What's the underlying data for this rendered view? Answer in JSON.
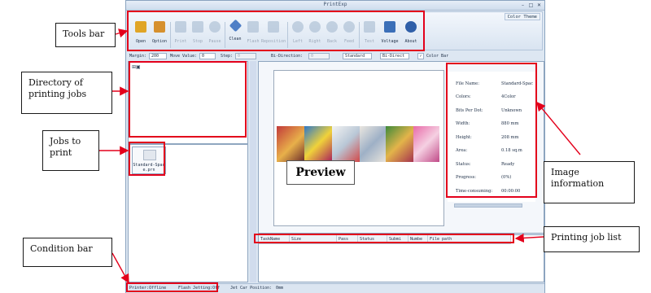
{
  "app": {
    "title": "PrintExp",
    "color_theme": "Color Theme",
    "window_controls": {
      "minimize": "–",
      "maximize": "□",
      "close": "✕"
    }
  },
  "toolbar": {
    "items": [
      {
        "label": "Open",
        "icon": "folder-open-icon",
        "enabled": true,
        "color": "#e0a526"
      },
      {
        "label": "Option",
        "icon": "settings-icon",
        "enabled": true,
        "color": "#d6902e"
      },
      {
        "label": "Print",
        "icon": "print-icon",
        "enabled": false,
        "color": "#9fb4cc"
      },
      {
        "label": "Stop",
        "icon": "stop-icon",
        "enabled": false,
        "color": "#9fb4cc"
      },
      {
        "label": "Pause",
        "icon": "pause-icon",
        "enabled": false,
        "color": "#9fb4cc"
      },
      {
        "label": "Clean",
        "icon": "clean-icon",
        "enabled": true,
        "color": "#4f7fc6"
      },
      {
        "label": "Flash",
        "icon": "flash-icon",
        "enabled": false,
        "color": "#9fb4cc"
      },
      {
        "label": "Reposition",
        "icon": "reposition-icon",
        "enabled": false,
        "color": "#9fb4cc"
      },
      {
        "label": "Left",
        "icon": "arrow-left-icon",
        "enabled": false,
        "color": "#9fb4cc"
      },
      {
        "label": "Right",
        "icon": "arrow-right-icon",
        "enabled": false,
        "color": "#9fb4cc"
      },
      {
        "label": "Back",
        "icon": "arrow-back-icon",
        "enabled": false,
        "color": "#9fb4cc"
      },
      {
        "label": "Feed",
        "icon": "arrow-feed-icon",
        "enabled": false,
        "color": "#9fb4cc"
      },
      {
        "label": "Test",
        "icon": "test-icon",
        "enabled": false,
        "color": "#9fb4cc"
      },
      {
        "label": "Voltage",
        "icon": "voltage-icon",
        "enabled": true,
        "color": "#3b6fb8"
      },
      {
        "label": "About",
        "icon": "about-icon",
        "enabled": true,
        "color": "#2f5fa8"
      }
    ]
  },
  "params": {
    "margin_label": "Margin:",
    "margin_value": "200",
    "move_value_label": "Move Value:",
    "move_value": "0",
    "step_label": "Step:",
    "step_value": "0",
    "bi_direction_label": "Bi-Direction:",
    "bi_direction_value": "0",
    "mode_value": "Standard",
    "direction_value": "Bi-Direct",
    "color_bar_label": "Color Bar",
    "color_bar_checked": true
  },
  "job_thumbnail": {
    "caption": "Standard-Spac\ne.prn"
  },
  "image_info": {
    "rows": [
      {
        "key": "File Name:",
        "value": "Standard-Spac"
      },
      {
        "key": "Colors:",
        "value": "4Color"
      },
      {
        "key": "Bits Per Dot:",
        "value": "Unknown"
      },
      {
        "key": "Width:",
        "value": "880 mm"
      },
      {
        "key": "Height:",
        "value": "208 mm"
      },
      {
        "key": "Area:",
        "value": "0.18 sq.m"
      },
      {
        "key": "Status:",
        "value": "Ready"
      },
      {
        "key": "Progress:",
        "value": "(0%)"
      },
      {
        "key": "Time-consuming:",
        "value": "00:00:00"
      }
    ]
  },
  "job_list": {
    "columns": [
      "TaskName",
      "Size",
      "Pass",
      "Status",
      "Submi",
      "Numbe",
      "File path"
    ]
  },
  "status_bar": {
    "printer_status": "Printer:Offline",
    "flash_status": "Flash Jetting:Off",
    "jet_car_position": "Jet Car Position:",
    "jet_car_value": "0mm"
  },
  "annotations": {
    "tools_bar": "Tools bar",
    "directory": "Directory of printing jobs",
    "jobs_to_print": "Jobs to print",
    "condition_bar": "Condition bar",
    "preview": "Preview",
    "image_information": "Image information",
    "printing_job_list": "Printing job list"
  },
  "colors": {
    "annotation_red": "#e3001b",
    "window_bg": "#dde7f2"
  }
}
